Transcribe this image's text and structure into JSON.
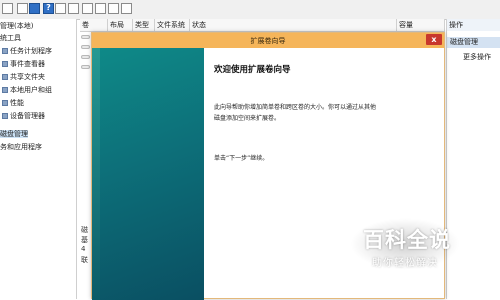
{
  "toolbar": {
    "icons": [
      "back-icon",
      "forward-icon",
      "pane-icon",
      "help-icon",
      "grid-icon",
      "doc-icon",
      "folder-icon",
      "disk-icon",
      "properties-icon"
    ]
  },
  "tree": {
    "items": [
      {
        "label": "管理(本地)"
      },
      {
        "label": "统工具"
      },
      {
        "label": "任务计划程序"
      },
      {
        "label": "事件查看器"
      },
      {
        "label": "共享文件夹"
      },
      {
        "label": "本地用户和组"
      },
      {
        "label": "性能"
      },
      {
        "label": "设备管理器"
      },
      {
        "label": "磁盘管理"
      },
      {
        "label": "务和应用程序"
      }
    ]
  },
  "columns": [
    "卷",
    "布局",
    "类型",
    "文件系统",
    "状态",
    "容量"
  ],
  "list": {
    "side_labels": [
      "磁",
      "基",
      "4",
      "联"
    ]
  },
  "actions": {
    "title": "操作",
    "section": "磁盘管理",
    "more": "更多操作"
  },
  "wizard": {
    "title": "扩展卷向导",
    "close": "x",
    "heading": "欢迎使用扩展卷向导",
    "desc_line1": "此向导帮助你增加简单卷和跨区卷的大小。你可以通过从其他",
    "desc_line2": "磁盘添加空间来扩展卷。",
    "hint": "单击“下一步”继续。"
  },
  "watermark": {
    "title": "百科全说",
    "subtitle": "助你轻松解决"
  }
}
